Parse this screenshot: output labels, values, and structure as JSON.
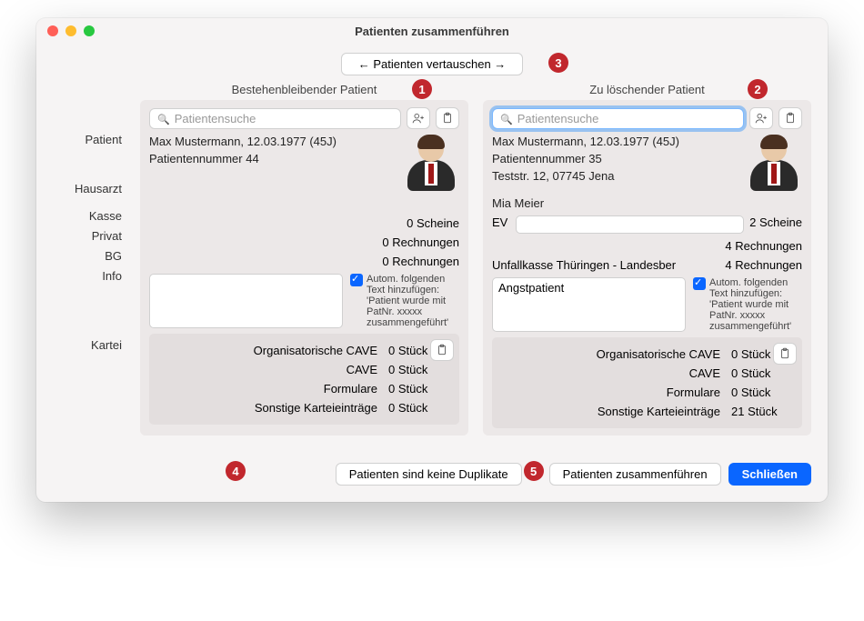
{
  "window": {
    "title": "Patienten zusammenführen"
  },
  "swap": {
    "label": "← Patienten vertauschen →"
  },
  "headers": {
    "keep": "Bestehenbleibender Patient",
    "delete": "Zu löschender Patient"
  },
  "labels": {
    "patient": "Patient",
    "hausarzt": "Hausarzt",
    "kasse": "Kasse",
    "privat": "Privat",
    "bg": "BG",
    "info": "Info",
    "kartei": "Kartei"
  },
  "search": {
    "placeholder": "Patientensuche"
  },
  "autoAppend": "Autom. folgenden Text hinzufügen: 'Patient wurde mit PatNr. xxxxx zusammengeführt'",
  "left": {
    "name": "Max Mustermann, 12.03.1977 (45J)",
    "nummer": "Patientennummer 44",
    "address": "",
    "hausarzt": "",
    "kasse_lhs": "",
    "kasse_rhs": "0 Scheine",
    "privat_rhs": "0 Rechnungen",
    "bg_lhs": "",
    "bg_rhs": "0 Rechnungen",
    "info_text": "",
    "kartei": {
      "orgcave": "0 Stück",
      "cave": "0 Stück",
      "formulare": "0 Stück",
      "sonstige": "0 Stück"
    }
  },
  "right": {
    "name": "Max Mustermann, 12.03.1977 (45J)",
    "nummer": "Patientennummer 35",
    "address": "Teststr. 12, 07745 Jena",
    "hausarzt": "Mia Meier",
    "kasse_lhs": "EV",
    "kasse_rhs": "2 Scheine",
    "privat_rhs": "4 Rechnungen",
    "bg_lhs": "Unfallkasse Thüringen - Landesber",
    "bg_rhs": "4 Rechnungen",
    "info_text": "Angstpatient",
    "kartei": {
      "orgcave": "0 Stück",
      "cave": "0 Stück",
      "formulare": "0 Stück",
      "sonstige": "21 Stück"
    }
  },
  "kartei_labels": {
    "orgcave": "Organisatorische CAVE",
    "cave": "CAVE",
    "formulare": "Formulare",
    "sonstige": "Sonstige Karteieinträge"
  },
  "footer": {
    "noDup": "Patienten sind keine Duplikate",
    "merge": "Patienten zusammenführen",
    "close": "Schließen"
  },
  "badges": {
    "b1": "1",
    "b2": "2",
    "b3": "3",
    "b4": "4",
    "b5": "5"
  }
}
